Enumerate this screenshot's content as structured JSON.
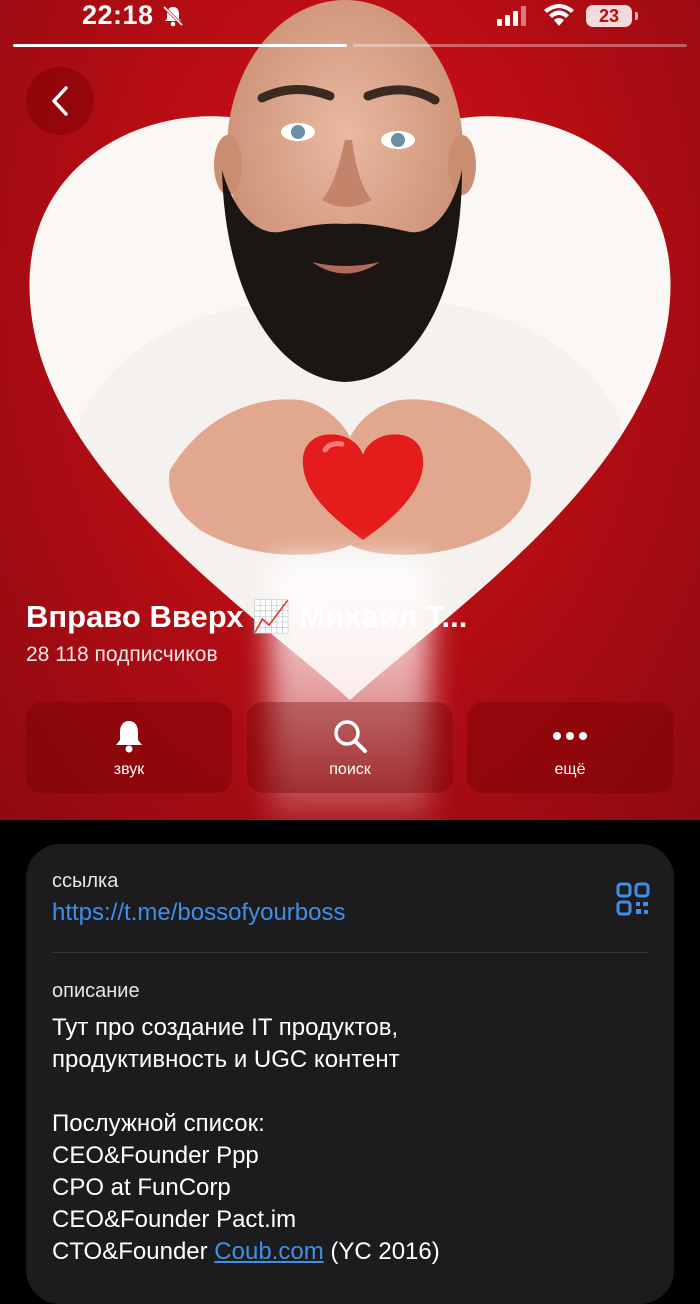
{
  "status_bar": {
    "time": "22:18",
    "battery": "23",
    "icons": [
      "bell-off-icon",
      "signal-icon",
      "wifi-icon",
      "battery-icon"
    ]
  },
  "story_progress": [
    1,
    0
  ],
  "colors": {
    "hero_red": "#c8101a",
    "link_blue": "#3f8fe8",
    "card_bg": "#1c1c1e",
    "page_bg": "#000000"
  },
  "header": {
    "title": "Вправо Вверх 📈 Михаил Т...",
    "subscribers": "28 118 подписчиков"
  },
  "actions": [
    {
      "label": "звук",
      "icon": "bell-icon"
    },
    {
      "label": "поиск",
      "icon": "search-icon"
    },
    {
      "label": "ещё",
      "icon": "more-icon"
    }
  ],
  "info": {
    "link_label": "ссылка",
    "link": "https://t.me/bossofyourboss",
    "description_label": "описание",
    "description_lines": [
      "Тут про создание IT продуктов,",
      "продуктивность и UGC контент",
      "",
      "Послужной список:",
      "CEO&Founder Ppp",
      "CPO at FunCorp",
      "CEO&Founder Pact.im"
    ],
    "last_line_prefix": "CTO&Founder ",
    "last_line_link": "Coub.com",
    "last_line_suffix": " (YC 2016)"
  }
}
